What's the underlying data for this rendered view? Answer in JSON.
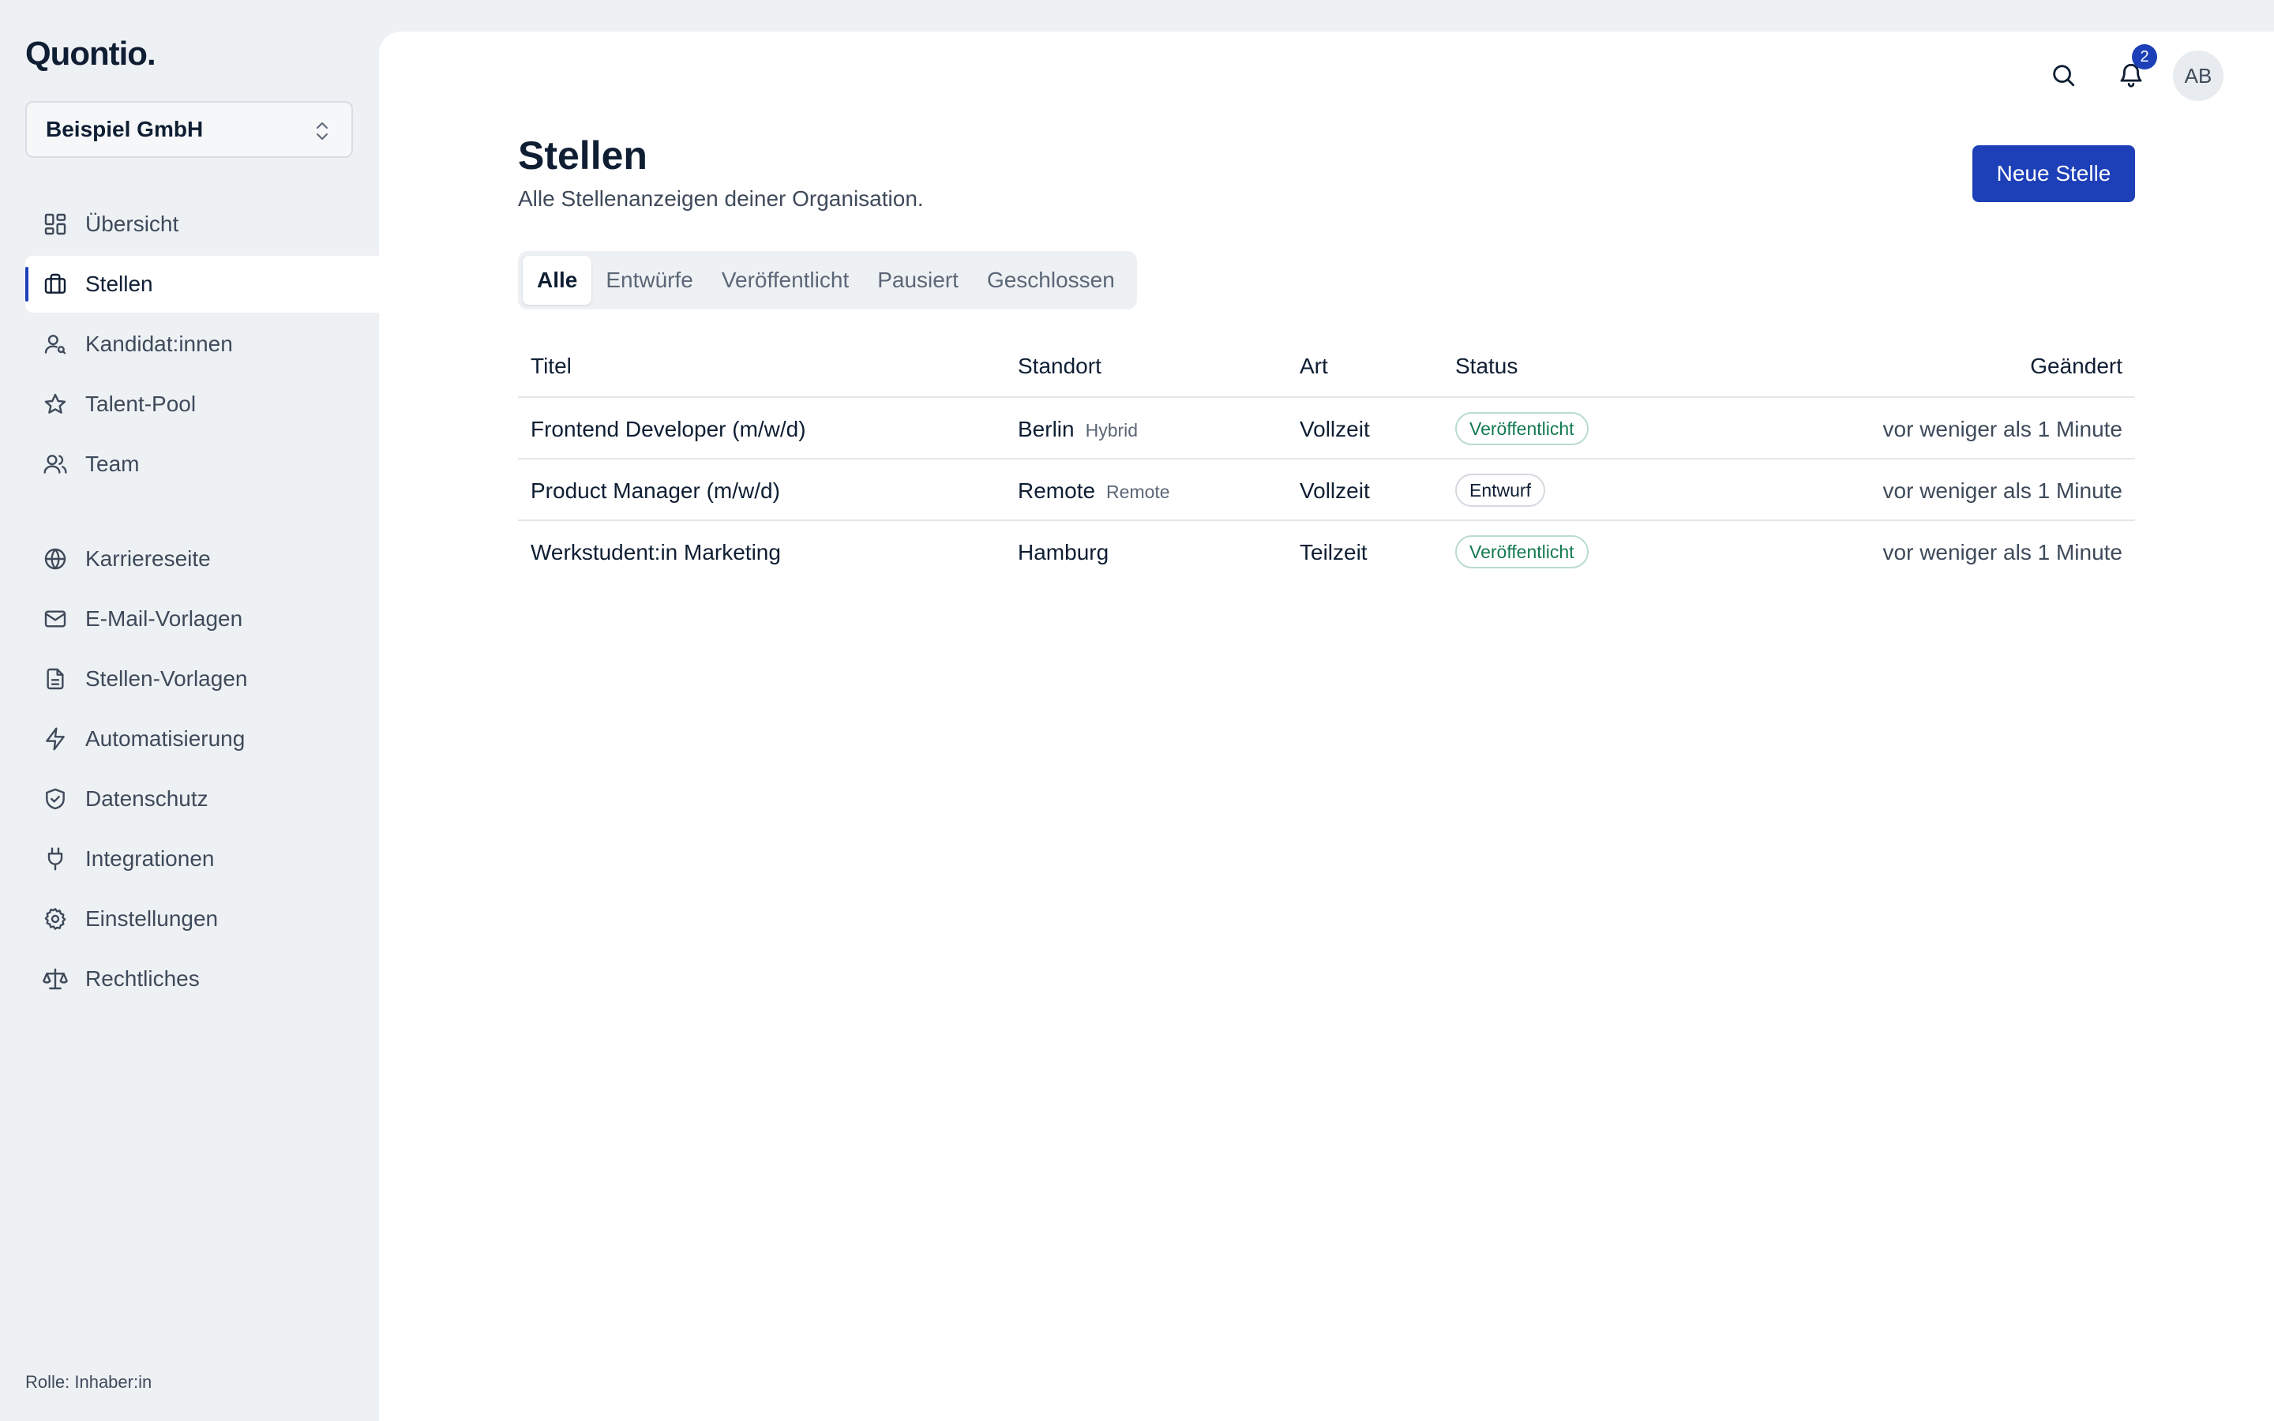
{
  "app": {
    "logo": "Quontio."
  },
  "org": {
    "name": "Beispiel GmbH"
  },
  "sidebar": {
    "items": [
      {
        "label": "Übersicht",
        "icon": "dashboard-icon"
      },
      {
        "label": "Stellen",
        "icon": "briefcase-icon",
        "active": true
      },
      {
        "label": "Kandidat:innen",
        "icon": "user-search-icon"
      },
      {
        "label": "Talent-Pool",
        "icon": "star-icon"
      },
      {
        "label": "Team",
        "icon": "users-icon"
      },
      {
        "label": "Karriereseite",
        "icon": "globe-icon"
      },
      {
        "label": "E-Mail-Vorlagen",
        "icon": "mail-icon"
      },
      {
        "label": "Stellen-Vorlagen",
        "icon": "file-text-icon"
      },
      {
        "label": "Automatisierung",
        "icon": "zap-icon"
      },
      {
        "label": "Datenschutz",
        "icon": "shield-check-icon"
      },
      {
        "label": "Integrationen",
        "icon": "plug-icon"
      },
      {
        "label": "Einstellungen",
        "icon": "gear-icon"
      },
      {
        "label": "Rechtliches",
        "icon": "scale-icon"
      }
    ],
    "role": "Rolle: Inhaber:in"
  },
  "topbar": {
    "notifications_count": "2",
    "avatar_initials": "AB"
  },
  "page": {
    "title": "Stellen",
    "subtitle": "Alle Stellenanzeigen deiner Organisation.",
    "new_button": "Neue Stelle"
  },
  "tabs": [
    {
      "label": "Alle",
      "active": true
    },
    {
      "label": "Entwürfe"
    },
    {
      "label": "Veröffentlicht"
    },
    {
      "label": "Pausiert"
    },
    {
      "label": "Geschlossen"
    }
  ],
  "table": {
    "columns": [
      "Titel",
      "Standort",
      "Art",
      "Status",
      "Geändert"
    ],
    "rows": [
      {
        "title": "Frontend Developer (m/w/d)",
        "location": "Berlin",
        "mode": "Hybrid",
        "type": "Vollzeit",
        "status": "Veröffentlicht",
        "status_kind": "published",
        "changed": "vor weniger als 1 Minute"
      },
      {
        "title": "Product Manager (m/w/d)",
        "location": "Remote",
        "mode": "Remote",
        "type": "Vollzeit",
        "status": "Entwurf",
        "status_kind": "draft",
        "changed": "vor weniger als 1 Minute"
      },
      {
        "title": "Werkstudent:in Marketing",
        "location": "Hamburg",
        "mode": "",
        "type": "Teilzeit",
        "status": "Veröffentlicht",
        "status_kind": "published",
        "changed": "vor weniger als 1 Minute"
      }
    ]
  },
  "colors": {
    "accent": "#1d3fb8",
    "published": "#137a4e",
    "sidebar_bg": "#eef1f4"
  }
}
